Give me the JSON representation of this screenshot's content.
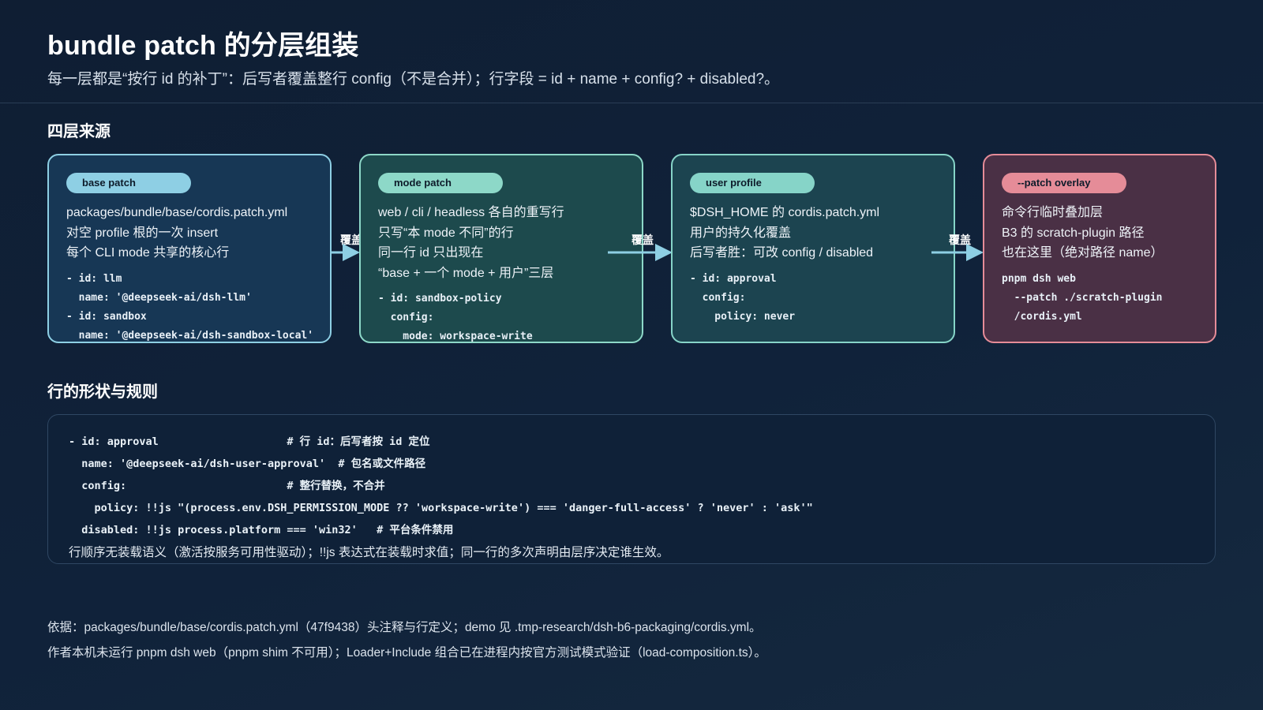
{
  "header": {
    "title": "bundle patch 的分层组装",
    "subtitle": "每一层都是“按行 id 的补丁”：后写者覆盖整行 config（不是合并）；行字段 = id + name + config? + disabled?。"
  },
  "section1_title": "四层来源",
  "cards": [
    {
      "tag": "base patch",
      "lines": [
        "packages/bundle/base/cordis.patch.yml",
        "对空 profile 根的一次 insert",
        "每个 CLI mode 共享的核心行"
      ],
      "code": [
        "- id: llm",
        "  name: '@deepseek-ai/dsh-llm'",
        "- id: sandbox",
        "  name: '@deepseek-ai/dsh-sandbox-local'"
      ]
    },
    {
      "tag": "mode patch",
      "lines": [
        "web / cli / headless 各自的重写行",
        "只写“本 mode 不同”的行",
        "同一行 id 只出现在",
        "“base + 一个 mode + 用户”三层"
      ],
      "code": [
        "- id: sandbox-policy",
        "  config:",
        "    mode: workspace-write"
      ]
    },
    {
      "tag": "user profile",
      "lines": [
        "$DSH_HOME 的 cordis.patch.yml",
        "用户的持久化覆盖",
        "后写者胜：可改 config / disabled"
      ],
      "code": [
        "- id: approval",
        "  config:",
        "    policy: never"
      ]
    },
    {
      "tag": "--patch overlay",
      "lines": [
        "命令行临时叠加层",
        "B3 的 scratch-plugin 路径",
        "也在这里（绝对路径 name）"
      ],
      "code": [
        "pnpm dsh web",
        "  --patch ./scratch-plugin",
        "  /cordis.yml"
      ]
    }
  ],
  "arrows": [
    "覆盖",
    "覆盖",
    "覆盖"
  ],
  "section2_title": "行的形状与规则",
  "rule_code": [
    "- id: approval                    # 行 id：后写者按 id 定位",
    "  name: '@deepseek-ai/dsh-user-approval'  # 包名或文件路径",
    "  config:                         # 整行替换，不合并",
    "    policy: !!js \"(process.env.DSH_PERMISSION_MODE ?? 'workspace-write') === 'danger-full-access' ? 'never' : 'ask'\"",
    "  disabled: !!js process.platform === 'win32'   # 平台条件禁用"
  ],
  "rule_note": "行顺序无装载语义（激活按服务可用性驱动）；!!js 表达式在装载时求值；同一行的多次声明由层序决定谁生效。",
  "footer": [
    "依据：packages/bundle/base/cordis.patch.yml（47f9438）头注释与行定义；demo 见 .tmp-research/dsh-b6-packaging/cordis.yml。",
    "作者本机未运行 pnpm dsh web（pnpm shim 不可用）；Loader+Include 组合已在进程内按官方测试模式验证（load-composition.ts）。"
  ],
  "colors": {
    "base": "#8ecfe4",
    "mode": "#8dd8c8",
    "user": "#86d4c8",
    "overlay": "#e58c98",
    "arrow": "#8ecfe4"
  }
}
